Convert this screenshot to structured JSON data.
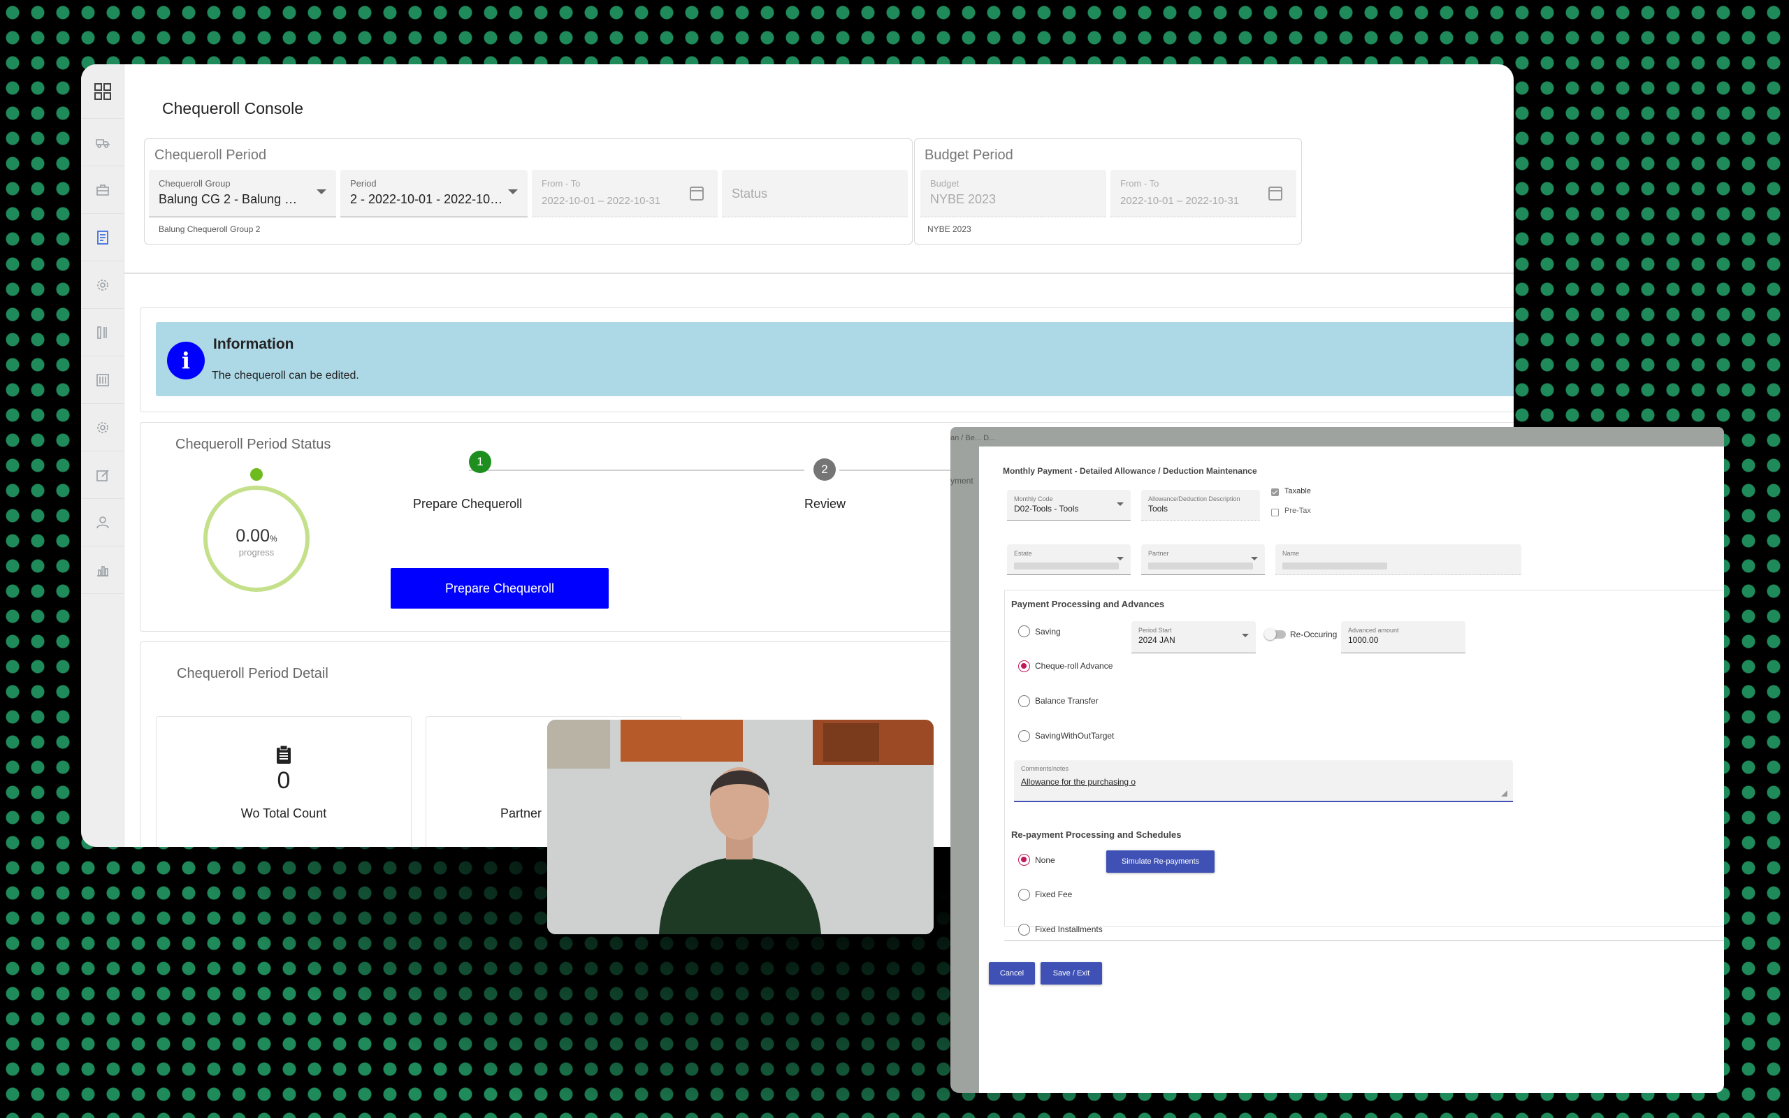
{
  "sidebar": {
    "icons": [
      "apps-icon",
      "truck-icon",
      "toolbox-icon",
      "document-icon",
      "gear-icon",
      "tools-icon",
      "sliders-icon",
      "gear-icon",
      "edit-icon",
      "user-icon",
      "bar-chart-icon"
    ]
  },
  "header": {
    "title": "Chequeroll Console"
  },
  "chequeroll_period": {
    "legend": "Chequeroll Period",
    "group": {
      "label": "Chequeroll Group",
      "value": "Balung CG 2 - Balung Ch...",
      "hint": "Balung Chequeroll Group 2"
    },
    "period": {
      "label": "Period",
      "value": "2 - 2022-10-01 - 2022-10-..."
    },
    "from_to": {
      "label": "From - To",
      "value": "2022-10-01 – 2022-10-31"
    },
    "status": {
      "label": "Status"
    }
  },
  "budget_period": {
    "legend": "Budget Period",
    "budget": {
      "label": "Budget",
      "value": "NYBE 2023",
      "hint": "NYBE 2023"
    },
    "from_to": {
      "label": "From - To",
      "value": "2022-10-01 – 2022-10-31"
    }
  },
  "info": {
    "title": "Information",
    "message": "The chequeroll can be edited.",
    "icon": "i"
  },
  "status_section": {
    "title": "Chequeroll Period Status",
    "progress": {
      "value": "0.00",
      "unit": "%",
      "label": "progress",
      "fraction": 0
    },
    "steps": [
      {
        "number": "1",
        "label": "Prepare Chequeroll",
        "color": "#1e8e1e"
      },
      {
        "number": "2",
        "label": "Review",
        "color": "#757575"
      }
    ],
    "prepare_button": "Prepare Chequeroll"
  },
  "detail_section": {
    "title": "Chequeroll Period Detail",
    "cards": [
      {
        "icon": "clipboard-icon",
        "value": "0",
        "label": "Wo Total Count"
      },
      {
        "label": "Partner"
      }
    ]
  },
  "dialog": {
    "breadcrumb": "an / Be... D...",
    "side_tab": "yment",
    "title": "Monthly Payment - Detailed Allowance / Deduction Maintenance",
    "monthly_code": {
      "label": "Monthly Code",
      "value": "D02-Tools - Tools"
    },
    "description": {
      "label": "Allowance/Deduction Description",
      "value": "Tools"
    },
    "taxable": {
      "label": "Taxable",
      "checked": true
    },
    "pretax": {
      "label": "Pre-Tax",
      "checked": false
    },
    "estate": {
      "label": "Estate"
    },
    "partner": {
      "label": "Partner"
    },
    "name": {
      "label": "Name"
    },
    "payment_section": "Payment Processing and Advances",
    "payment_options": [
      {
        "label": "Saving",
        "selected": false
      },
      {
        "label": "Cheque-roll Advance",
        "selected": true
      },
      {
        "label": "Balance Transfer",
        "selected": false
      },
      {
        "label": "SavingWithOutTarget",
        "selected": false
      }
    ],
    "period_start": {
      "label": "Period Start",
      "value": "2024 JAN"
    },
    "recurring": {
      "label": "Re-Occuring"
    },
    "advanced_amount": {
      "label": "Advanced amount",
      "value": "1000.00"
    },
    "comments": {
      "label": "Comments/notes",
      "value": "Allowance for the purchasing o"
    },
    "repayment_section": "Re-payment Processing and Schedules",
    "repayment_options": [
      {
        "label": "None",
        "selected": true
      },
      {
        "label": "Fixed Fee",
        "selected": false
      },
      {
        "label": "Fixed Installments",
        "selected": false
      }
    ],
    "simulate_button": "Simulate Re-payments",
    "cancel_button": "Cancel",
    "save_button": "Save / Exit"
  },
  "colors": {
    "accent_blue": "#0000ff",
    "info_bg": "#add8e6",
    "indigo": "#3f51b5",
    "progress_ring": "#c5e08a"
  }
}
